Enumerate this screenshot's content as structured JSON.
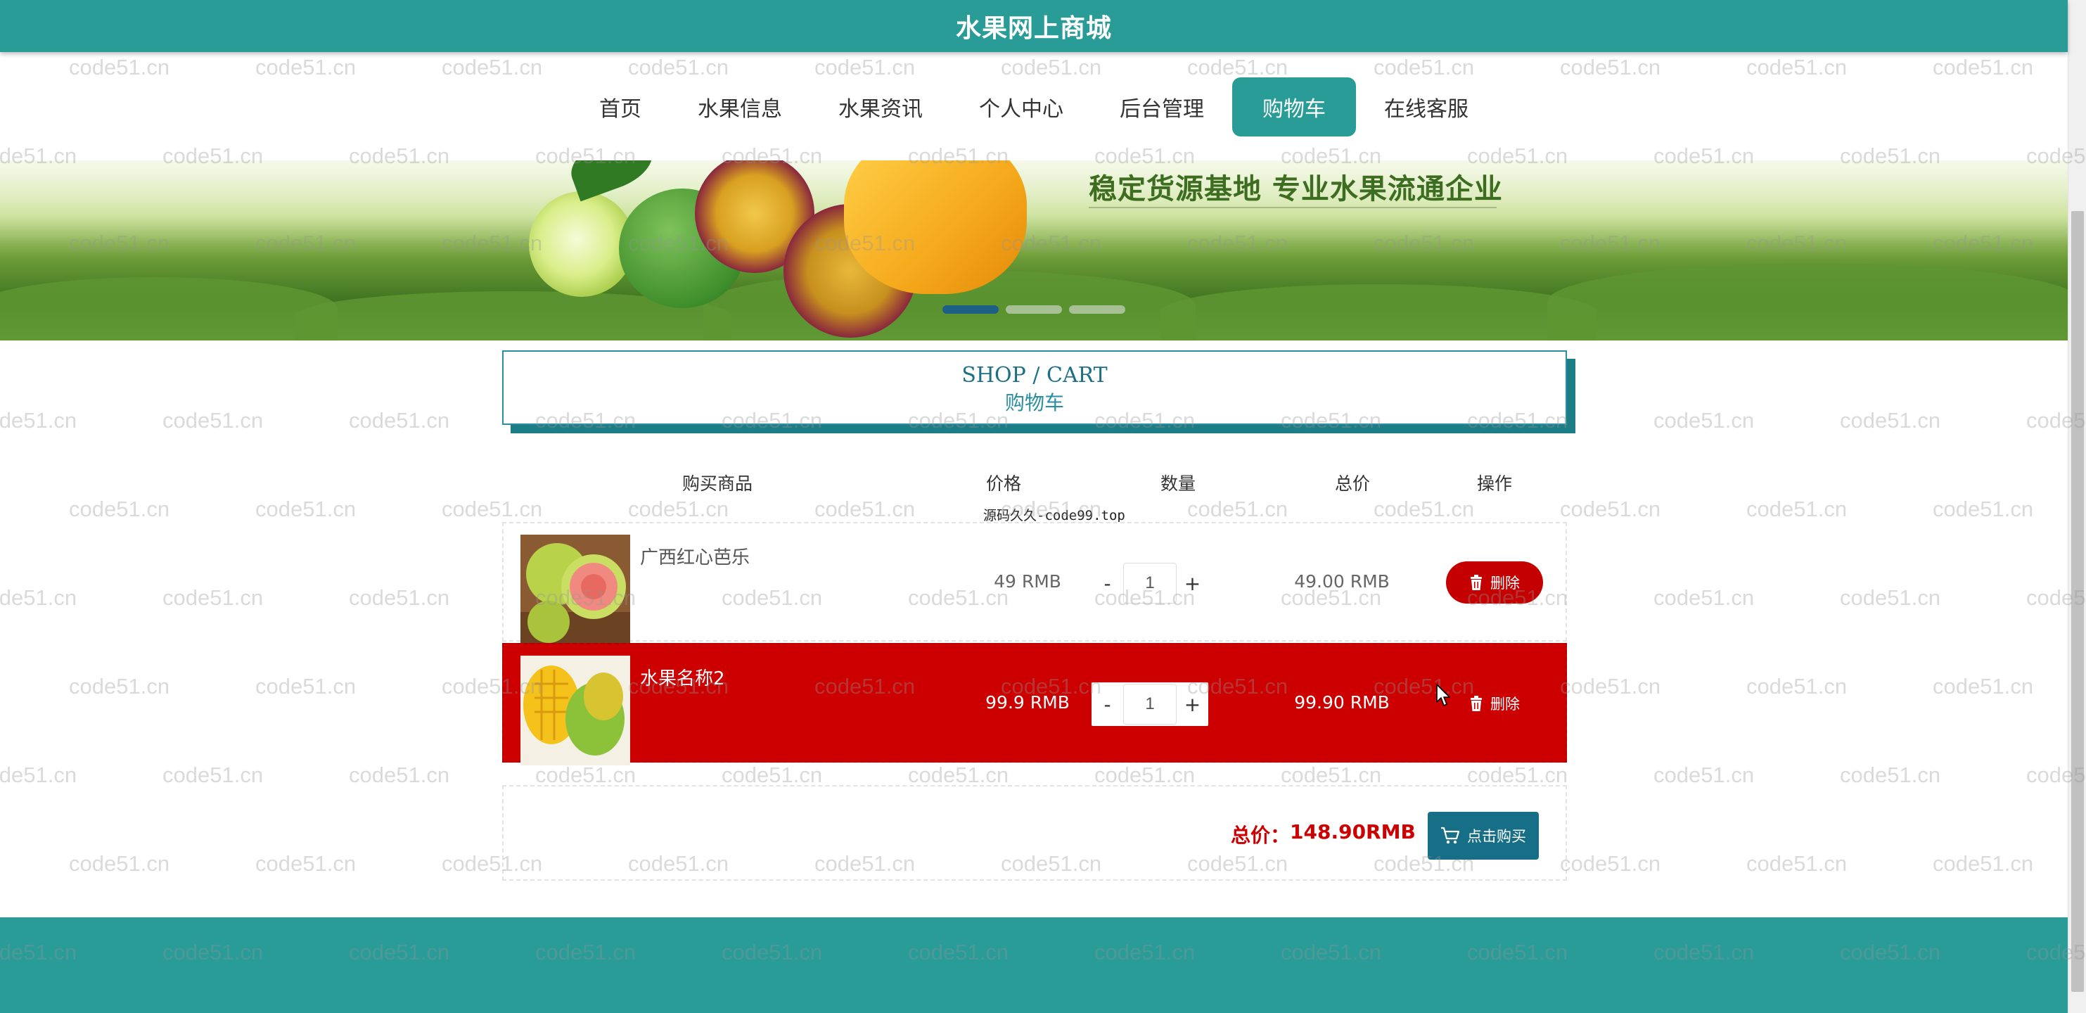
{
  "site": {
    "title": "水果网上商城"
  },
  "nav": {
    "items": [
      {
        "label": "首页"
      },
      {
        "label": "水果信息"
      },
      {
        "label": "水果资讯"
      },
      {
        "label": "个人中心"
      },
      {
        "label": "后台管理"
      },
      {
        "label": "购物车",
        "active": true
      },
      {
        "label": "在线客服"
      }
    ]
  },
  "banner": {
    "caption": "稳定货源基地 专业水果流通企业",
    "slide_count": 3,
    "active_slide": 1
  },
  "section": {
    "title_en": "SHOP / CART",
    "title_cn": "购物车"
  },
  "table": {
    "headers": {
      "product": "购买商品",
      "price": "价格",
      "quantity": "数量",
      "total": "总价",
      "action": "操作"
    },
    "source_watermark": "源码久久-code99.top",
    "rows": [
      {
        "name": "广西红心芭乐",
        "price": "49 RMB",
        "qty": "1",
        "total": "49.00 RMB",
        "delete_label": "删除",
        "highlighted": false
      },
      {
        "name": "水果名称2",
        "price": "99.9 RMB",
        "qty": "1",
        "total": "99.90 RMB",
        "delete_label": "删除",
        "highlighted": true
      }
    ],
    "qty_minus": "-",
    "qty_plus": "+"
  },
  "summary": {
    "label": "总价：",
    "value": "148.90RMB",
    "buy_label": "点击购买"
  },
  "watermark": {
    "text": "code51.cn"
  },
  "colors": {
    "primary": "#299c98",
    "danger": "#cc0000",
    "buy": "#166f86"
  }
}
